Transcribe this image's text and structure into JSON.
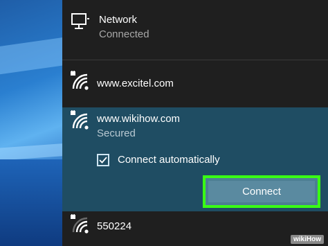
{
  "networks": {
    "wired": {
      "name": "Network",
      "status": "Connected",
      "icon": "monitor-icon"
    },
    "excitel": {
      "name": "www.excitel.com",
      "icon": "wifi-secured-icon"
    },
    "wikihow": {
      "name": "www.wikihow.com",
      "status": "Secured",
      "icon": "wifi-secured-icon",
      "auto_connect_label": "Connect automatically",
      "auto_connect_checked": true,
      "connect_label": "Connect"
    },
    "other": {
      "name": "550224",
      "icon": "wifi-secured-icon"
    }
  },
  "watermark": "wikiHow",
  "colors": {
    "panel": "#1f1f1f",
    "selected": "#1f4d63",
    "button": "#5a8aa0",
    "highlight": "#39ff14"
  }
}
